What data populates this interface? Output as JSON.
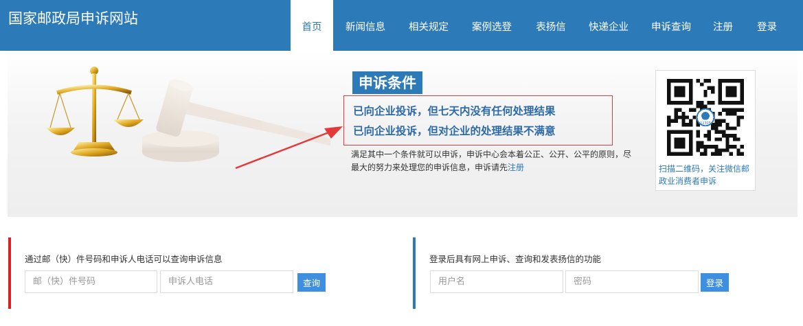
{
  "header": {
    "site_title": "国家邮政局申诉网站",
    "nav": [
      {
        "label": "首页",
        "active": true
      },
      {
        "label": "新闻信息"
      },
      {
        "label": "相关规定"
      },
      {
        "label": "案例选登"
      },
      {
        "label": "表扬信"
      },
      {
        "label": "快递企业"
      },
      {
        "label": "申诉查询"
      },
      {
        "label": "注册"
      },
      {
        "label": "登录"
      }
    ]
  },
  "banner": {
    "title": "申诉条件",
    "conditions": [
      "已向企业投诉，但七天内没有任何处理结果",
      "已向企业投诉，但对企业的处理结果不满意"
    ],
    "description": "满足其中一个条件就可以申诉，申诉中心会本着公正、公开、公平的原则，尽最大的努力来处理您的申诉信息，申诉请先",
    "register_link": "注册",
    "qr_caption": "扫描二维码，关注微信邮政业消费者申诉",
    "qr_logo_text": "12305"
  },
  "query_panel": {
    "description": "通过邮（快）件号码和申诉人电话可以查询申诉信息",
    "tracking_placeholder": "邮（快）件号码",
    "phone_placeholder": "申诉人电话",
    "button_label": "查询"
  },
  "login_panel": {
    "description": "登录后具有网上申诉、查询和发表扬信的功能",
    "username_placeholder": "用户名",
    "password_placeholder": "密码",
    "button_label": "登录"
  },
  "colors": {
    "header_bg": "#2d7ab8",
    "accent_red": "#e02020",
    "button_blue": "#3f8fe0"
  }
}
